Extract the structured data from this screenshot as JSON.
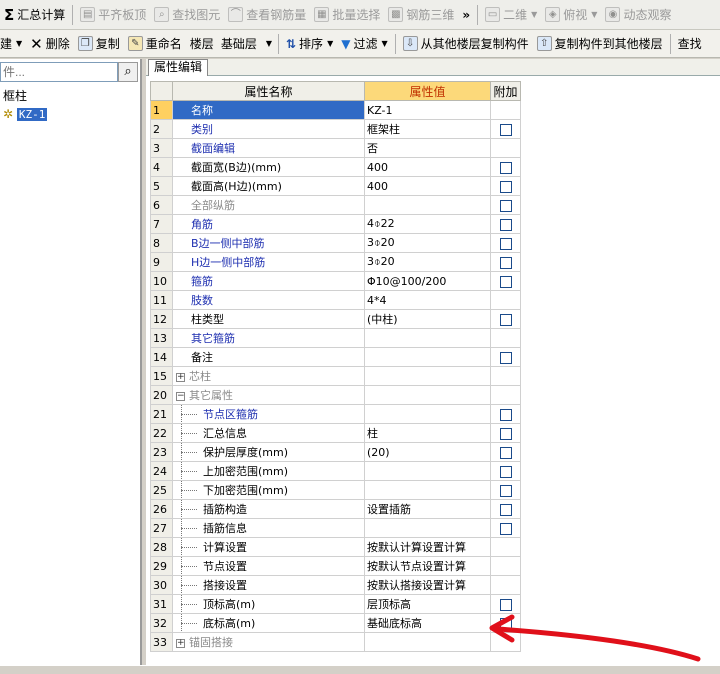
{
  "toolbar1": {
    "sum_label": "汇总计算",
    "flat_label": "平齐板顶",
    "find_label": "查找图元",
    "view_rebar_label": "查看钢筋量",
    "batch_select_label": "批量选择",
    "rebar3d_label": "钢筋三维",
    "more_label": "»",
    "view2d_label": "二维",
    "top_view_label": "俯视",
    "dynamic_label": "动态观察"
  },
  "toolbar2": {
    "new_label": "建",
    "delete_label": "删除",
    "copy_label": "复制",
    "rename_label": "重命名",
    "floor_label": "楼层",
    "floor_value": "基础层",
    "sort_label": "排序",
    "filter_label": "过滤",
    "copy_from_label": "从其他楼层复制构件",
    "copy_to_label": "复制构件到其他楼层",
    "find_label": "查找"
  },
  "left_panel": {
    "search_placeholder": "件...",
    "tree_root": "框柱",
    "tree_item": "KZ-1"
  },
  "tab": {
    "label": "属性编辑"
  },
  "grid_headers": {
    "name": "属性名称",
    "value": "属性值",
    "extra": "附加"
  },
  "rows": [
    {
      "num": "1",
      "name": "名称",
      "value": "KZ-1",
      "style": "sel",
      "chk": false
    },
    {
      "num": "2",
      "name": "类别",
      "value": "框架柱",
      "style": "blue",
      "chk": true
    },
    {
      "num": "3",
      "name": "截面编辑",
      "value": "否",
      "style": "blue",
      "chk": false
    },
    {
      "num": "4",
      "name": "截面宽(B边)(mm)",
      "value": "400",
      "style": "",
      "chk": true
    },
    {
      "num": "5",
      "name": "截面高(H边)(mm)",
      "value": "400",
      "style": "",
      "chk": true
    },
    {
      "num": "6",
      "name": "全部纵筋",
      "value": "",
      "style": "gray",
      "chk": true
    },
    {
      "num": "7",
      "name": "角筋",
      "value": "4⌽22",
      "style": "blue",
      "chk": true
    },
    {
      "num": "8",
      "name": "B边一侧中部筋",
      "value": "3⌽20",
      "style": "blue",
      "chk": true
    },
    {
      "num": "9",
      "name": "H边一侧中部筋",
      "value": "3⌽20",
      "style": "blue",
      "chk": true
    },
    {
      "num": "10",
      "name": "箍筋",
      "value": "Φ10@100/200",
      "style": "blue",
      "chk": true
    },
    {
      "num": "11",
      "name": "肢数",
      "value": "4*4",
      "style": "blue",
      "chk": false
    },
    {
      "num": "12",
      "name": "柱类型",
      "value": "(中柱)",
      "style": "",
      "chk": true
    },
    {
      "num": "13",
      "name": "其它箍筋",
      "value": "",
      "style": "blue",
      "chk": false
    },
    {
      "num": "14",
      "name": "备注",
      "value": "",
      "style": "",
      "chk": true
    },
    {
      "num": "15",
      "name": "芯柱",
      "value": "",
      "style": "group-plus",
      "chk": false
    },
    {
      "num": "20",
      "name": "其它属性",
      "value": "",
      "style": "group-minus",
      "chk": false
    },
    {
      "num": "21",
      "name": "节点区箍筋",
      "value": "",
      "style": "sub-blue",
      "chk": true
    },
    {
      "num": "22",
      "name": "汇总信息",
      "value": "柱",
      "style": "sub",
      "chk": true
    },
    {
      "num": "23",
      "name": "保护层厚度(mm)",
      "value": "(20)",
      "style": "sub",
      "chk": true
    },
    {
      "num": "24",
      "name": "上加密范围(mm)",
      "value": "",
      "style": "sub",
      "chk": true
    },
    {
      "num": "25",
      "name": "下加密范围(mm)",
      "value": "",
      "style": "sub",
      "chk": true
    },
    {
      "num": "26",
      "name": "插筋构造",
      "value": "设置插筋",
      "style": "sub",
      "chk": true
    },
    {
      "num": "27",
      "name": "插筋信息",
      "value": "",
      "style": "sub",
      "chk": true
    },
    {
      "num": "28",
      "name": "计算设置",
      "value": "按默认计算设置计算",
      "style": "sub",
      "chk": false
    },
    {
      "num": "29",
      "name": "节点设置",
      "value": "按默认节点设置计算",
      "style": "sub",
      "chk": false
    },
    {
      "num": "30",
      "name": "搭接设置",
      "value": "按默认搭接设置计算",
      "style": "sub",
      "chk": false
    },
    {
      "num": "31",
      "name": "顶标高(m)",
      "value": "层顶标高",
      "style": "sub",
      "chk": true
    },
    {
      "num": "32",
      "name": "底标高(m)",
      "value": "基础底标高",
      "style": "sub",
      "chk": true
    },
    {
      "num": "33",
      "name": "锚固搭接",
      "value": "",
      "style": "group-plus",
      "chk": false
    }
  ],
  "annotation": {
    "color": "#e0101a"
  }
}
